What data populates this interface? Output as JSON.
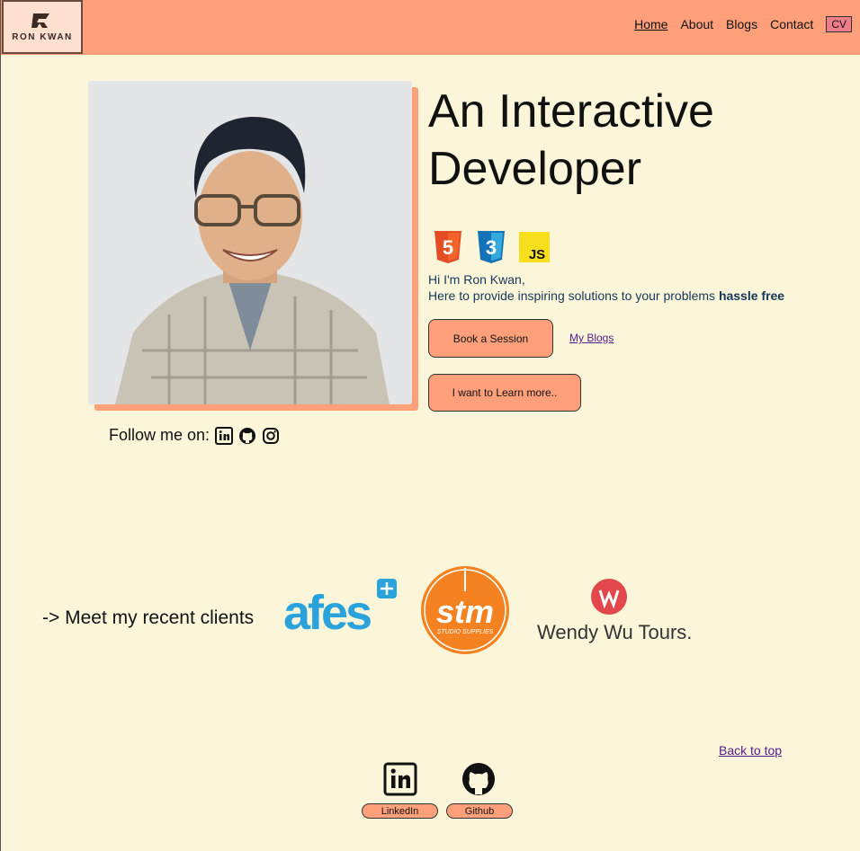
{
  "header": {
    "logo_text": "RON KWAN",
    "nav": [
      "Home",
      "About",
      "Blogs",
      "Contact"
    ],
    "cv_label": "CV"
  },
  "hero": {
    "headline_line1": "An Interactive",
    "headline_line2": "Developer",
    "tech_icons": [
      "html5-icon",
      "css3-icon",
      "javascript-icon"
    ],
    "js_label": "JS",
    "html_label": "5",
    "css_label": "3",
    "intro_line1": "Hi I'm Ron Kwan,",
    "intro_line2": "Here to provide inspiring solutions to your problems ",
    "intro_bold": "hassle free",
    "book_label": "Book a Session",
    "blogs_link": "My Blogs",
    "learn_label": "I want to Learn more..",
    "follow_label": "Follow me on:"
  },
  "clients": {
    "title": "-> Meet my recent clients",
    "afes": "afes",
    "stm": "stm",
    "stm_sub": "STUDIO SUPPLIES",
    "wendy": "Wendy Wu Tours."
  },
  "footer": {
    "back_to_top": "Back to top",
    "linkedin_label": "LinkedIn",
    "github_label": "Github"
  },
  "colors": {
    "accent": "#ffa07a",
    "background": "#fbf6d9"
  }
}
